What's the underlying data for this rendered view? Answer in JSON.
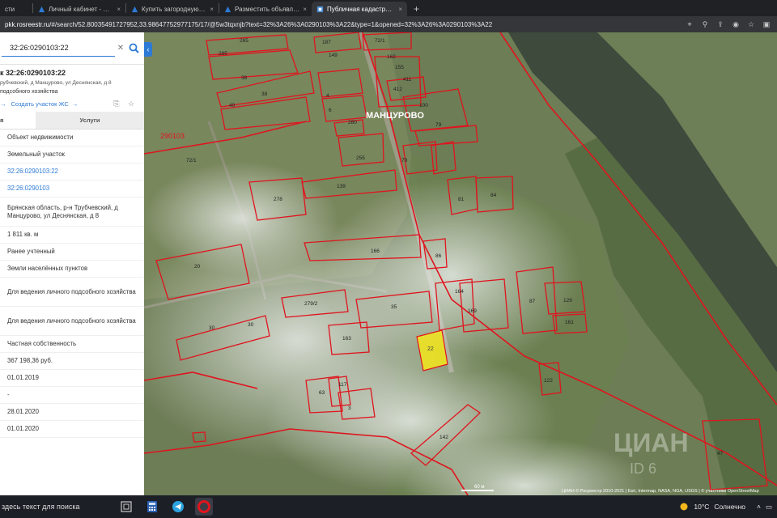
{
  "browser": {
    "tabs": [
      {
        "label": "сти",
        "active": false
      },
      {
        "label": "Личный кабинет - ЦИАН",
        "active": false
      },
      {
        "label": "Купить загородную недв",
        "active": false
      },
      {
        "label": "Разместить объявление о",
        "active": false
      },
      {
        "label": "Публичная кадастровая к",
        "active": true
      }
    ],
    "tab_close": "×",
    "new_tab": "+",
    "url_host": "pkk.rosreestr.ru",
    "url_rest": "/#/search/52.80035491727952,33.98647752977175/17/@5w3tqxnjb?text=32%3A26%3A0290103%3A22&type=1&opened=32%3A26%3A0290103%3A22"
  },
  "panel": {
    "search_value": "32:26:0290103:22",
    "object_title": "к 32:26:0290103:22",
    "object_address": "рубчевский, д Манцурово, ул Деснянская, д 8",
    "object_use": "подсобного хозяйства",
    "create_link": "Создать участок ЖС",
    "tabs": [
      "я",
      "Услуги"
    ],
    "rows": [
      {
        "text": "Объект недвижимости",
        "kind": "text"
      },
      {
        "text": "Земельный участок",
        "kind": "text"
      },
      {
        "text": "32:26:0290103:22",
        "kind": "link"
      },
      {
        "text": "32:26:0290103",
        "kind": "link"
      },
      {
        "text": "Брянская область, р-н Трубчевский, д Манцурово, ул Деснянская, д 8",
        "kind": "tall"
      },
      {
        "text": "1 811 кв. м",
        "kind": "text"
      },
      {
        "text": "Ранее учтенный",
        "kind": "text"
      },
      {
        "text": "Земли населённых пунктов",
        "kind": "text"
      },
      {
        "text": "Для ведения личного подсобного хозяйства",
        "kind": "tall"
      },
      {
        "text": "Для ведения личного подсобного хозяйства",
        "kind": "tall"
      },
      {
        "text": "Частная собственность",
        "kind": "text"
      },
      {
        "text": "367 198,36 руб.",
        "kind": "text"
      },
      {
        "text": "01.01.2019",
        "kind": "text"
      },
      {
        "text": "-",
        "kind": "text"
      },
      {
        "text": "28.01.2020",
        "kind": "text"
      },
      {
        "text": "01.01.2020",
        "kind": "text"
      }
    ]
  },
  "map": {
    "village_label": "МАНЦУРОВО",
    "quarter_label": "290103",
    "selected_label": "22",
    "scale_label": "60 м",
    "attribution": "ЦИАН © Росреестр 2010-2021 | Esri, Intermap, NASA, NGA, USGS | © участники OpenStreetMap",
    "watermark": "ЦИАН",
    "watermark_id": "ID 6",
    "parcel_labels": [
      "265",
      "285",
      "187",
      "72/1",
      "149",
      "162",
      "38",
      "38",
      "155",
      "411",
      "412",
      "40",
      "4",
      "6",
      "100",
      "280",
      "79",
      "255",
      "72/1",
      "79",
      "139",
      "278",
      "81",
      "84",
      "166",
      "86",
      "164",
      "20",
      "279/2",
      "35",
      "169",
      "87",
      "129",
      "30",
      "30",
      "163",
      "161",
      "63",
      "117",
      "3",
      "142",
      "122",
      "47"
    ],
    "colors": {
      "parcel": "#e0141e",
      "selected_fill": "#f3e61b",
      "river": "#3e4a3c"
    }
  },
  "taskbar": {
    "search_text": "здесь текст для поиска",
    "temperature": "10°C",
    "weather": "Солнечно"
  }
}
